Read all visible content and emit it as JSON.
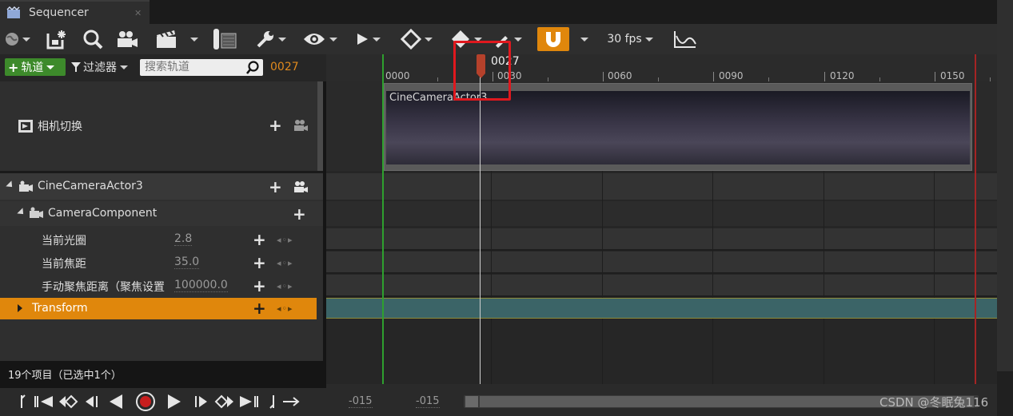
{
  "tab": {
    "title": "Sequencer"
  },
  "toolbar": {
    "fps": "30 fps",
    "icons": [
      "world-icon",
      "save-icon",
      "find-icon",
      "camera-icon",
      "clapboard-icon",
      "render-icon",
      "tools-icon",
      "eye-icon",
      "play-icon",
      "key-icon",
      "auto-key-icon",
      "edit-icon",
      "snap-icon",
      "curve-icon"
    ],
    "snap_color": "#e0870c"
  },
  "left_header": {
    "add_track_label": "轨道",
    "filter_label": "过滤器",
    "search_placeholder": "搜索轨道",
    "current_frame": "0027"
  },
  "tree": {
    "camera_cuts": {
      "label": "相机切换"
    },
    "actor": {
      "label": "CineCameraActor3"
    },
    "component": {
      "label": "CameraComponent"
    },
    "properties": [
      {
        "label": "当前光圈",
        "value": "2.8"
      },
      {
        "label": "当前焦距",
        "value": "35.0"
      },
      {
        "label": "手动聚焦距离（聚焦设置",
        "value": "100000.0"
      }
    ],
    "transform": {
      "label": "Transform",
      "highlight_color": "#e0870c"
    }
  },
  "status": {
    "text": "19个项目（已选中1个）"
  },
  "timeline": {
    "ticks": [
      "0000",
      "0030",
      "0060",
      "0090",
      "0120",
      "0150"
    ],
    "playhead_label": "0027",
    "shot_label": "CineCameraActor3"
  },
  "bottom": {
    "start_value": "-015",
    "end_value": "-015"
  },
  "watermark": "CSDN @冬眠兔116"
}
